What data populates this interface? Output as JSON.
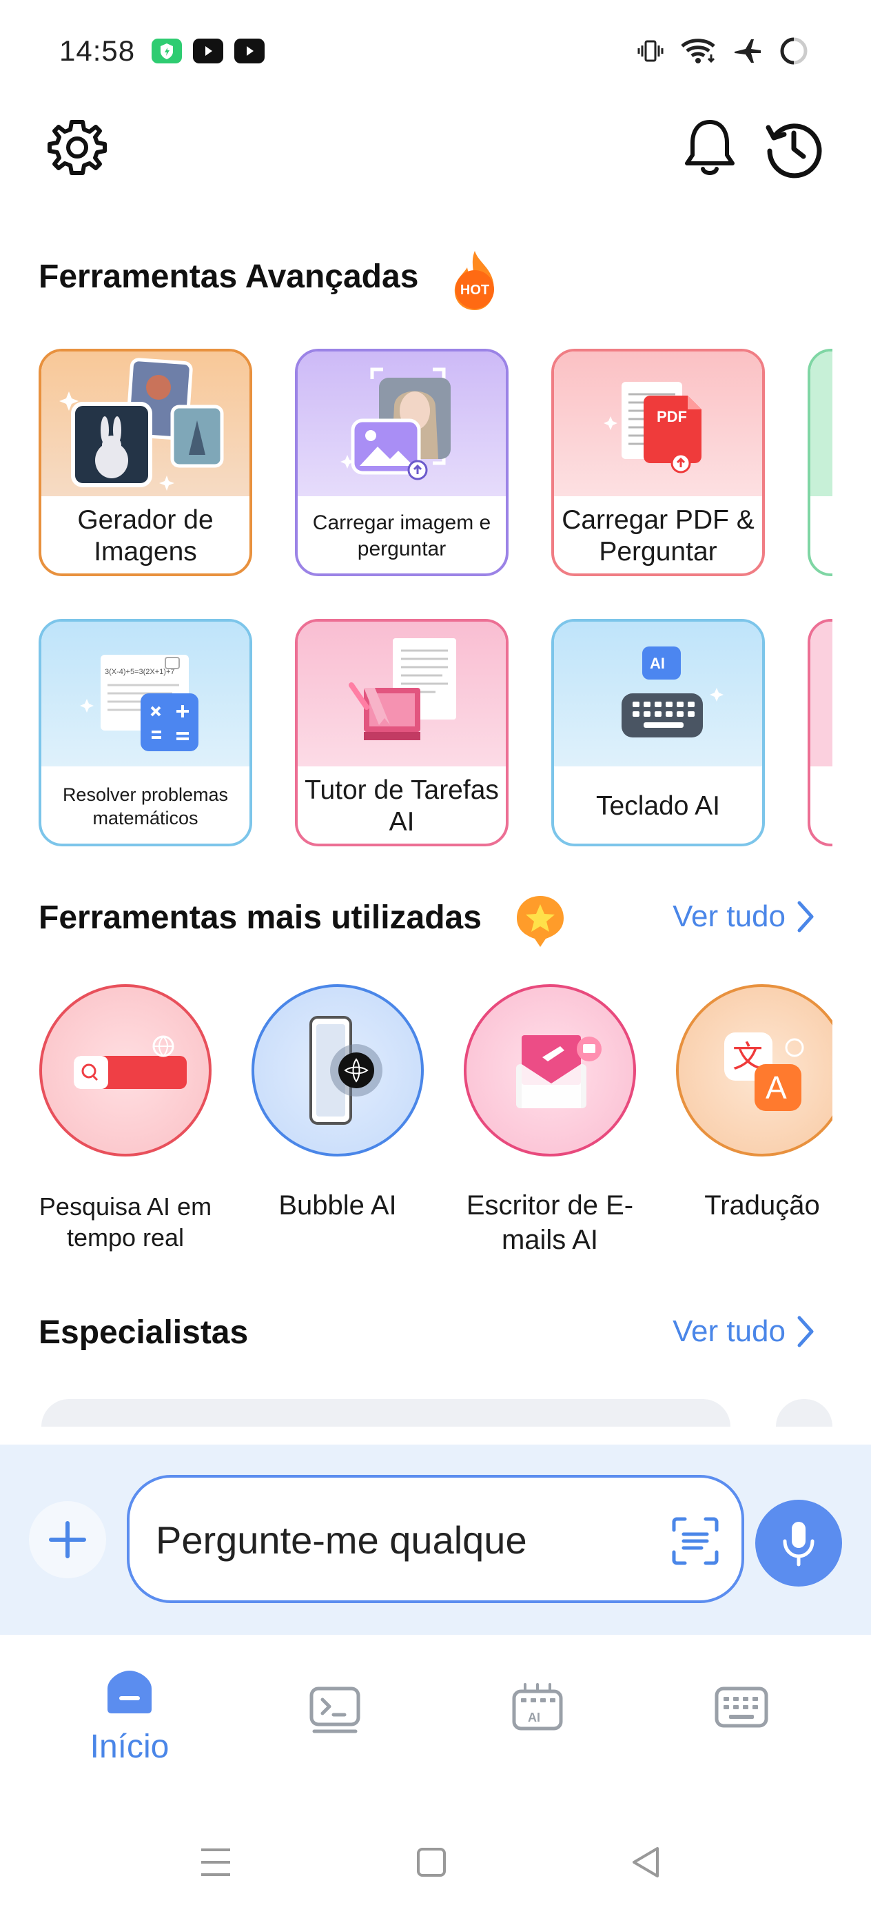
{
  "status_bar": {
    "time": "14:58",
    "icons": [
      "vpn-app-icon",
      "youtube-icon",
      "youtube-icon",
      "vibrate-icon",
      "wifi-icon",
      "airplane-icon",
      "loading-icon"
    ]
  },
  "top_bar": {
    "icons": [
      "gear-icon",
      "bell-icon",
      "history-icon"
    ]
  },
  "advanced_tools": {
    "title": "Ferramentas Avançadas",
    "badge": "HOT",
    "row1": [
      {
        "label": "Gerador de Imagens",
        "color": "#e8913e"
      },
      {
        "label": "Carregar imagem e perguntar",
        "color": "#9b83e6"
      },
      {
        "label": "Carregar PDF & Perguntar",
        "color": "#f07d84"
      }
    ],
    "row2": [
      {
        "label": "Resolver problemas matemáticos",
        "color": "#7cc5ea"
      },
      {
        "label": "Tutor de Tarefas AI",
        "color": "#ec6f94"
      },
      {
        "label": "Teclado AI",
        "color": "#7cc5ea"
      }
    ],
    "pdf_badge": "PDF",
    "ai_badge": "AI",
    "math_text": "3(X-4)+5=3(2X+1)+7"
  },
  "most_used": {
    "title": "Ferramentas mais utilizadas",
    "see_all": "Ver tudo",
    "items": [
      {
        "label": "Pesquisa AI em tempo real",
        "color": "#e8505b"
      },
      {
        "label": "Bubble AI",
        "color": "#4a86e8"
      },
      {
        "label": "Escritor de E-mails AI",
        "color": "#e84a7d"
      },
      {
        "label": "Tradução",
        "color": "#e8913e"
      }
    ],
    "translate_glyphs": {
      "zh": "文",
      "en": "A"
    }
  },
  "specialists": {
    "title": "Especialistas",
    "see_all": "Ver tudo"
  },
  "composer": {
    "placeholder": "Pergunte-me qualque"
  },
  "bottom_nav": {
    "items": [
      {
        "label": "Início",
        "active": true
      },
      {
        "label": "",
        "icon": "terminal-icon"
      },
      {
        "label": "",
        "icon": "ai-keyboard-icon"
      },
      {
        "label": "",
        "icon": "keyboard-icon"
      }
    ],
    "ai_label": "AI"
  },
  "colors": {
    "accent": "#4a86e8",
    "composer_bg": "#e8f1fc"
  }
}
